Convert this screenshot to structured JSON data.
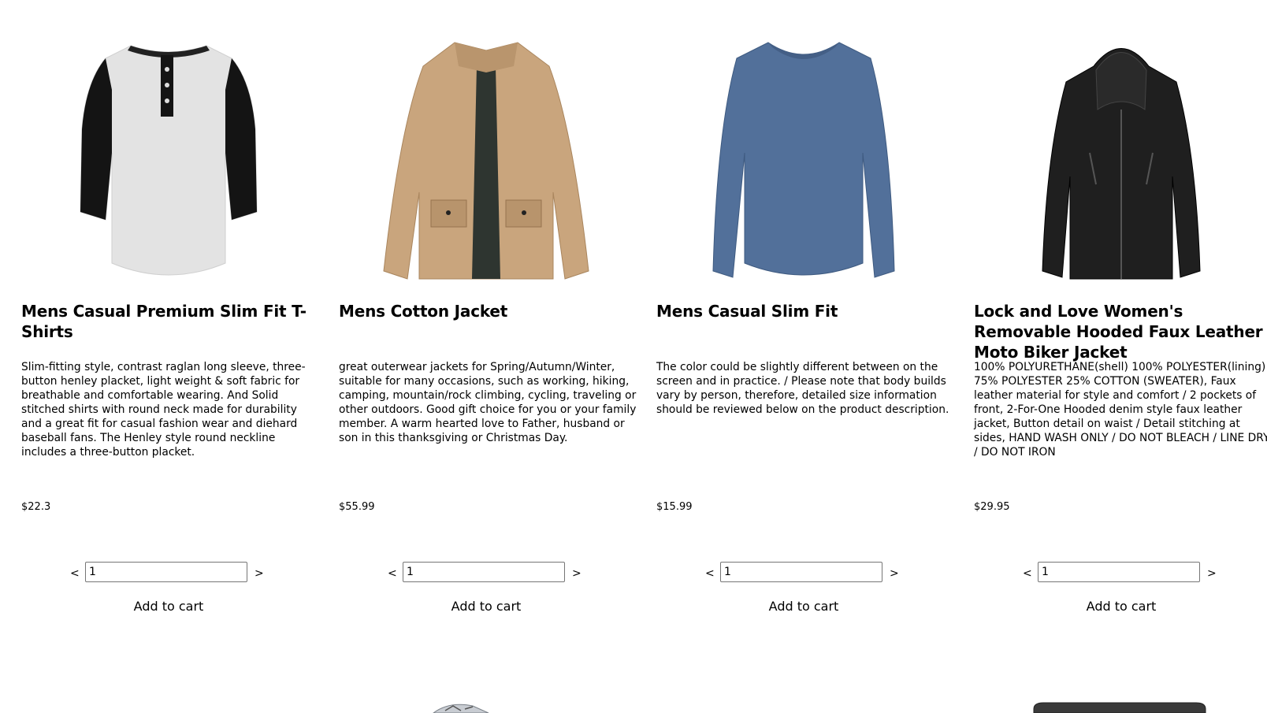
{
  "products": [
    {
      "title": "Mens Casual Premium Slim Fit T-Shirts",
      "description": "Slim-fitting style, contrast raglan long sleeve, three-button henley placket, light weight & soft fabric for breathable and comfortable wearing. And Solid stitched shirts with round neck made for durability and a great fit for casual fashion wear and diehard baseball fans. The Henley style round neckline includes a three-button placket.",
      "price": "$22.3",
      "quantity": "1",
      "image_icon": "henley-tshirt-image"
    },
    {
      "title": "Mens Cotton Jacket",
      "description": "great outerwear jackets for Spring/Autumn/Winter, suitable for many occasions, such as working, hiking, camping, mountain/rock climbing, cycling, traveling or other outdoors. Good gift choice for you or your family member. A warm hearted love to Father, husband or son in this thanksgiving or Christmas Day.",
      "price": "$55.99",
      "quantity": "1",
      "image_icon": "cotton-jacket-image"
    },
    {
      "title": "Mens Casual Slim Fit",
      "description": "The color could be slightly different between on the screen and in practice. / Please note that body builds vary by person, therefore, detailed size information should be reviewed below on the product description.",
      "price": "$15.99",
      "quantity": "1",
      "image_icon": "long-sleeve-shirt-image"
    },
    {
      "title": "Lock and Love Women's Removable Hooded Faux Leather Moto Biker Jacket",
      "description": "100% POLYURETHANE(shell) 100% POLYESTER(lining) 75% POLYESTER 25% COTTON (SWEATER), Faux leather material for style and comfort / 2 pockets of front, 2-For-One Hooded denim style faux leather jacket, Button detail on waist / Detail stitching at sides, HAND WASH ONLY / DO NOT BLEACH / LINE DRY / DO NOT IRON",
      "price": "$29.95",
      "quantity": "1",
      "image_icon": "leather-jacket-image"
    }
  ],
  "controls": {
    "decrement": "<",
    "increment": ">",
    "add_to_cart": "Add to cart"
  },
  "colors": {
    "tshirt_body": "#e6e6e6",
    "tshirt_sleeve": "#111111",
    "jacket_tan": "#c9a57d",
    "shirt_blue": "#52709a",
    "leather_black": "#1c1c1c"
  }
}
